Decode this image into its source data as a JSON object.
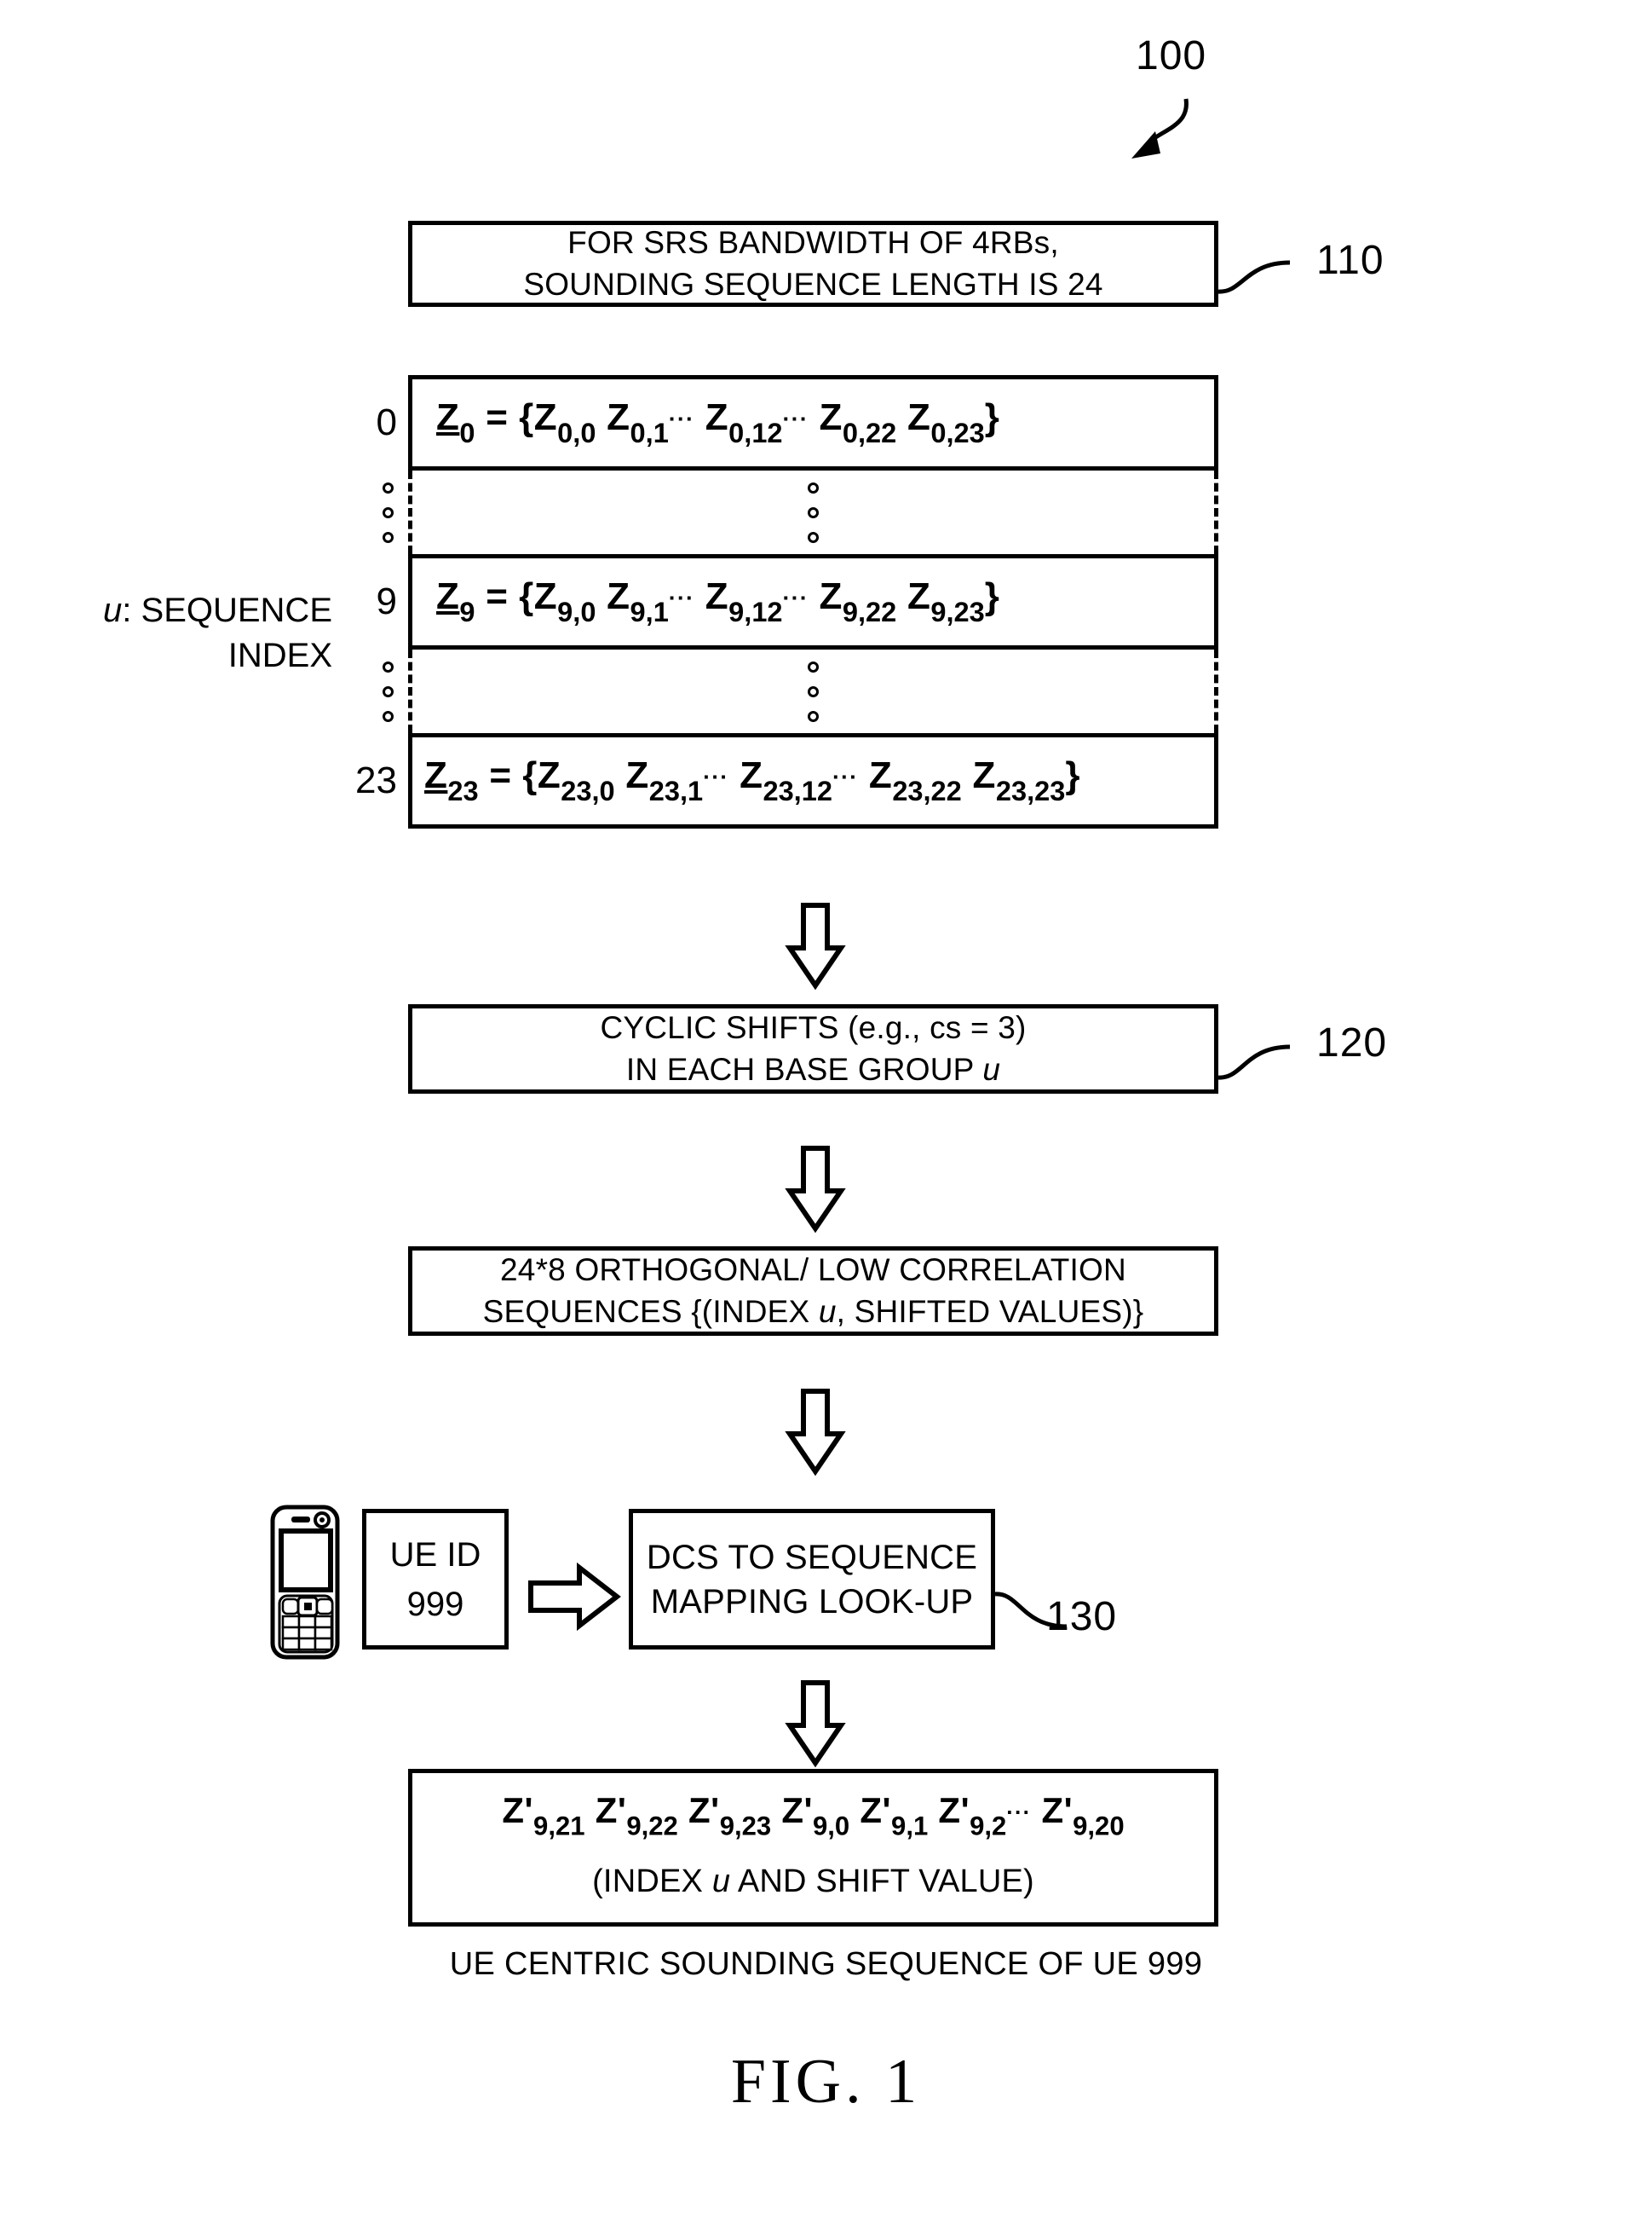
{
  "figure": {
    "label": "FIG. 1",
    "main_ref": "100",
    "caption": "UE CENTRIC SOUNDING SEQUENCE OF UE 999"
  },
  "axis_label": {
    "line1_prefix": "u",
    "line1_suffix": ": SEQUENCE",
    "line2": "INDEX"
  },
  "steps": [
    {
      "ref": "110",
      "lines": [
        "FOR SRS BANDWIDTH OF 4RBs,",
        "SOUNDING SEQUENCE LENGTH IS 24"
      ]
    },
    {
      "ref": "120",
      "line1": "CYCLIC SHIFTS (e.g., cs = 3)",
      "line2_prefix": "IN EACH BASE GROUP ",
      "line2_italic": "u"
    },
    {
      "ref": "",
      "line1": "24*8 ORTHOGONAL/ LOW CORRELATION",
      "line2_a": "SEQUENCES {(INDEX ",
      "line2_italic": "u",
      "line2_b": ", SHIFTED VALUES)}"
    },
    {
      "ref": "130",
      "line1": "DCS TO SEQUENCE",
      "line2": "MAPPING LOOK-UP"
    }
  ],
  "ue": {
    "id_label": "UE ID",
    "id_value": "999",
    "device_icon": "mobile-phone-icon"
  },
  "sequence_table": {
    "rows": [
      {
        "type": "sequence",
        "index": "0",
        "vector": "Z",
        "vector_sub": "0",
        "elements": [
          "0,0",
          "0,1",
          "0,12",
          "0,22",
          "0,23"
        ],
        "ellipsis_after": [
          1,
          2
        ]
      },
      {
        "type": "ellipsis",
        "index": "",
        "marks": 3
      },
      {
        "type": "sequence",
        "index": "9",
        "vector": "Z",
        "vector_sub": "9",
        "elements": [
          "9,0",
          "9,1",
          "9,12",
          "9,22",
          "9,23"
        ],
        "ellipsis_after": [
          1,
          2
        ]
      },
      {
        "type": "ellipsis",
        "index": "",
        "marks": 3
      },
      {
        "type": "sequence",
        "index": "23",
        "vector": "Z",
        "vector_sub": "23",
        "elements": [
          "23,0",
          "23,1",
          "23,12",
          "23,22",
          "23,23"
        ],
        "ellipsis_after": [
          1,
          2
        ]
      }
    ]
  },
  "output_box": {
    "prime_symbol": "Z'",
    "elements": [
      "9,21",
      "9,22",
      "9,23",
      "9,0",
      "9,1",
      "9,2",
      "9,20"
    ],
    "ellipsis_after_index": 5,
    "subtitle_a": "(INDEX ",
    "subtitle_italic": "u",
    "subtitle_b": " AND SHIFT VALUE)"
  },
  "colors": {
    "ink": "#000000",
    "paper": "#ffffff"
  }
}
